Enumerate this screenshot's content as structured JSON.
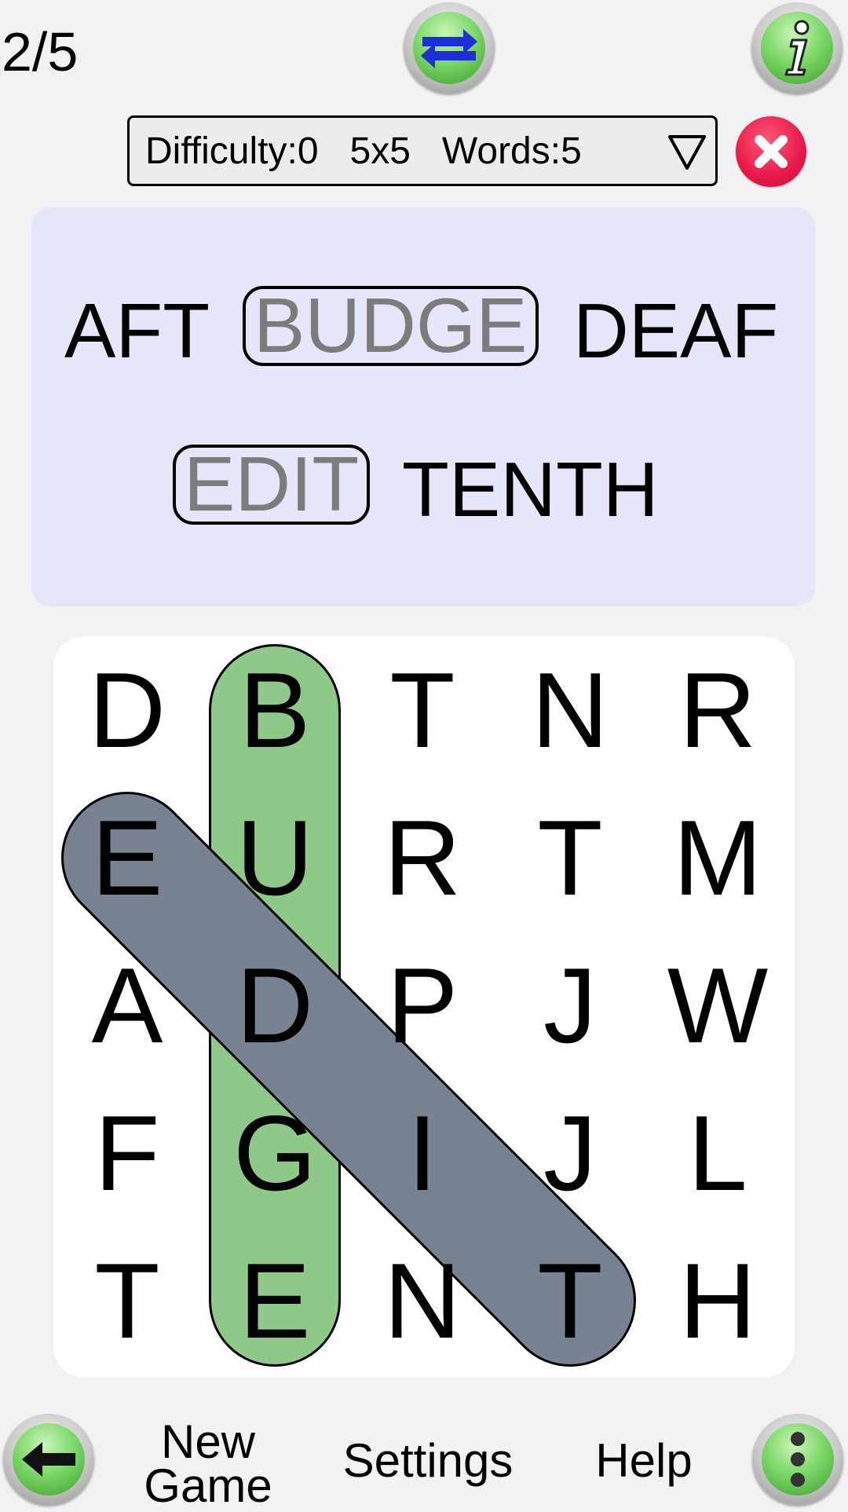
{
  "header": {
    "progress": "2/5"
  },
  "settings": {
    "label": "Difficulty:0   5x5   Words:5",
    "dropdown_icon": "triangle-down-icon"
  },
  "words": [
    {
      "text": "AFT",
      "found": false
    },
    {
      "text": "BUDGE",
      "found": true
    },
    {
      "text": "DEAF",
      "found": false
    },
    {
      "text": "EDIT",
      "found": true
    },
    {
      "text": "TENTH",
      "found": false
    }
  ],
  "grid": {
    "rows": [
      [
        "D",
        "B",
        "T",
        "N",
        "R"
      ],
      [
        "E",
        "U",
        "R",
        "T",
        "M"
      ],
      [
        "A",
        "D",
        "P",
        "J",
        "W"
      ],
      [
        "F",
        "G",
        "I",
        "J",
        "L"
      ],
      [
        "T",
        "E",
        "N",
        "T",
        "H"
      ]
    ],
    "highlights": [
      {
        "word": "BUDGE",
        "from": [
          0,
          1
        ],
        "to": [
          4,
          1
        ],
        "color": "#8fc98a"
      },
      {
        "word": "EDIT",
        "from": [
          1,
          0
        ],
        "to": [
          4,
          3
        ],
        "color": "#8d99ab"
      }
    ]
  },
  "footer": {
    "new_game_line1": "New",
    "new_game_line2": "Game",
    "settings": "Settings",
    "help": "Help"
  },
  "colors": {
    "background": "#f2f2f4",
    "panel": "#e6e6fa",
    "accent_green": "#7ed86a",
    "close_red": "#e8184a"
  }
}
